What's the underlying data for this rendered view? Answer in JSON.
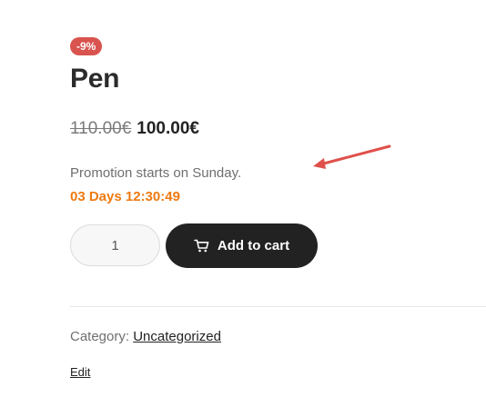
{
  "product": {
    "badge": "-9%",
    "title": "Pen",
    "old_price": "110.00€",
    "new_price": "100.00€",
    "promotion_text": "Promotion starts on Sunday.",
    "countdown": "03 Days 12:30:49"
  },
  "cart": {
    "quantity": "1",
    "add_label": "Add to cart",
    "icon": "cart-icon"
  },
  "meta": {
    "category_label": "Category:",
    "category_value": "Uncategorized",
    "edit_label": "Edit"
  },
  "colors": {
    "badge": "#d9534f",
    "countdown": "#ee7a12",
    "button": "#222222",
    "arrow": "#e0504a"
  }
}
